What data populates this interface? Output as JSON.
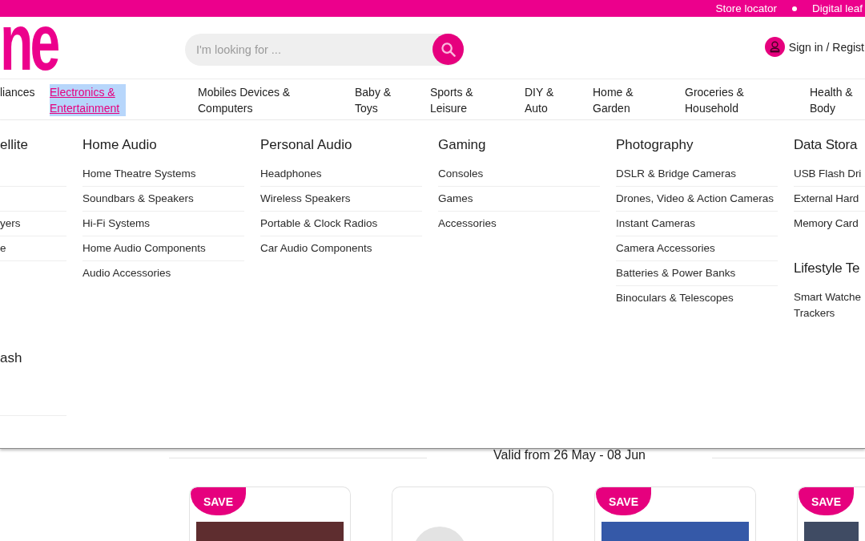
{
  "top_bar": {
    "links": [
      "Store locator",
      "Digital leaf"
    ]
  },
  "header": {
    "logo": "ne",
    "search": {
      "placeholder": "I'm looking for ..."
    },
    "account_link": "Sign in / Regist"
  },
  "nav": [
    {
      "label": "liances",
      "selected": false
    },
    {
      "label": "Electronics & Entertainment",
      "selected": true
    },
    {
      "label": "Mobiles Devices & Computers",
      "selected": false
    },
    {
      "label": "Baby & Toys",
      "selected": false
    },
    {
      "label": "Sports & Leisure",
      "selected": false
    },
    {
      "label": "DIY & Auto",
      "selected": false
    },
    {
      "label": "Home & Garden",
      "selected": false
    },
    {
      "label": "Groceries & Household",
      "selected": false
    },
    {
      "label": "Health & Body",
      "selected": false
    }
  ],
  "mega_menu": {
    "columns": [
      {
        "kind": "cut-left",
        "sections": [
          {
            "heading": "ellite",
            "items": [
              "yers",
              "e"
            ]
          },
          {
            "heading": "ash"
          }
        ]
      },
      {
        "kind": "full",
        "sections": [
          {
            "heading": "Home Audio",
            "items": [
              "Home Theatre Systems",
              "Soundbars & Speakers",
              "Hi-Fi Systems",
              "Home Audio Components",
              "Audio Accessories"
            ]
          }
        ]
      },
      {
        "kind": "full",
        "sections": [
          {
            "heading": "Personal Audio",
            "items": [
              "Headphones",
              "Wireless Speakers",
              "Portable & Clock Radios",
              "Car Audio Components"
            ]
          }
        ]
      },
      {
        "kind": "full",
        "sections": [
          {
            "heading": "Gaming",
            "items": [
              "Consoles",
              "Games",
              "Accessories"
            ]
          }
        ]
      },
      {
        "kind": "full",
        "sections": [
          {
            "heading": "Photography",
            "items": [
              "DSLR & Bridge Cameras",
              "Drones, Video & Action Cameras",
              "Instant Cameras",
              "Camera Accessories",
              "Batteries & Power Banks",
              "Binoculars & Telescopes"
            ]
          }
        ]
      },
      {
        "kind": "cut-right",
        "sections": [
          {
            "heading": "Data Stora",
            "items": [
              "USB Flash Dri",
              "External Hard",
              "Memory Card"
            ]
          },
          {
            "heading": "Lifestyle Te",
            "items": [
              "Smart Watche Trackers"
            ]
          }
        ]
      }
    ]
  },
  "offer_banner": {
    "validity": "Valid from 26 May - 08 Jun"
  },
  "products": [
    {
      "badge": "SAVE",
      "kind": "photo"
    },
    {
      "kind": "placeholder"
    },
    {
      "badge": "SAVE",
      "kind": "photo"
    },
    {
      "badge": "SAVE",
      "kind": "photo"
    }
  ]
}
